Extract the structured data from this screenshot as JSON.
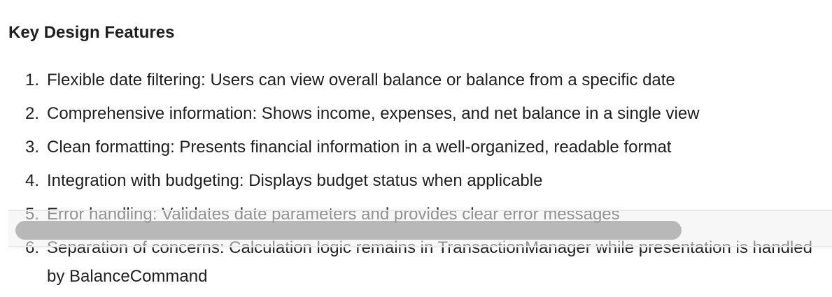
{
  "heading": "Key Design Features",
  "features": [
    {
      "num": "1.",
      "text": "Flexible date filtering: Users can view overall balance or balance from a specific date"
    },
    {
      "num": "2.",
      "text": "Comprehensive information: Shows income, expenses, and net balance in a single view"
    },
    {
      "num": "3.",
      "text": "Clean formatting: Presents financial information in a well-organized, readable format"
    },
    {
      "num": "4.",
      "text": "Integration with budgeting: Displays budget status when applicable"
    },
    {
      "num": "5.",
      "text": "Error handling: Validates date parameters and provides clear error messages"
    },
    {
      "num": "6.",
      "text": "Separation of concerns: Calculation logic remains in TransactionManager while presentation is handled by BalanceCommand"
    }
  ]
}
